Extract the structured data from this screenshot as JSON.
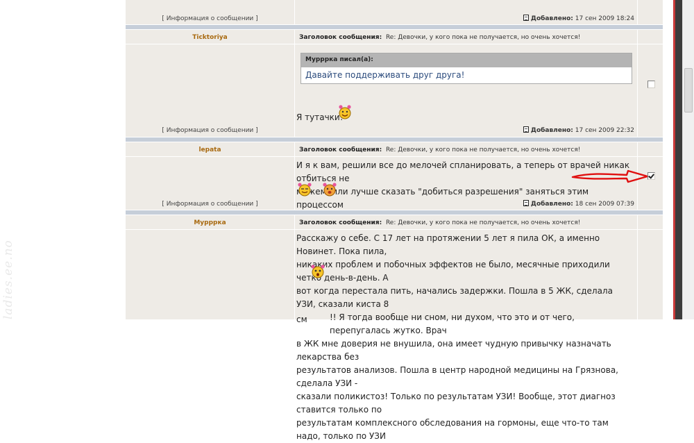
{
  "watermark": "ladies.ee.no",
  "labels": {
    "info": "[ Информация о сообщении ]",
    "subject_prefix": "Заголовок сообщения:",
    "added_prefix": "Добавлено:"
  },
  "posts": [
    {
      "posted_time": "17 сен 2009 18:24"
    },
    {
      "author": "Ticktoriya",
      "subject": "Re: Девочки, у кого пока не получается, но очень хочется!",
      "quote_header": "Мурррка писал(а):",
      "quote_text": "Давайте поддерживать друг друга!",
      "body": "Я тутачки!",
      "posted_time": "17 сен 2009 22:32",
      "checked": false
    },
    {
      "author": "lepata",
      "subject": "Re: Девочки, у кого пока не получается, но очень хочется!",
      "body_line1": "И я к вам, решили все до мелочей спланировать, а теперь от врачей никак отбиться не",
      "body_line2": "можем, или лучше сказать \"добиться разрешения\" заняться этим процессом",
      "posted_time": "18 сен 2009 07:39",
      "checked": true
    },
    {
      "author": "Мурррка",
      "subject": "Re: Девочки, у кого пока не получается, но очень хочется!",
      "body_lines": [
        "Расскажу о себе. С 17 лет на протяжении 5 лет я пила ОК, а именно Новинет. Пока пила,",
        "никаких проблем и побочных эффектов не было, месячные приходили четко день-в-день. А",
        "вот когда перестала пить, начались задержки. Пошла в 5 ЖК, сделала УЗИ, сказали киста 8",
        "см",
        "!! Я тогда вообще ни сном, ни духом, что это и от чего, перепугалась жутко. Врач",
        "в ЖК мне доверия не внушила, она имеет чудную привычку назначать лекарства без",
        "результатов анализов. Пошла в центр народной медицины на Грязнова, сделала УЗИ -",
        "сказали поликистоз! Только по результатам УЗИ! Вообще, этот диагноз ставится только по",
        "результатам комплексного обследования на гормоны, еще что-то там надо, только по УЗИ"
      ]
    }
  ],
  "colors": {
    "forum_bg": "#eeebe6",
    "separator": "#c6ced9",
    "author": "#a8690f",
    "quote_text": "#2a4a7c",
    "arrow": "#e01010"
  }
}
